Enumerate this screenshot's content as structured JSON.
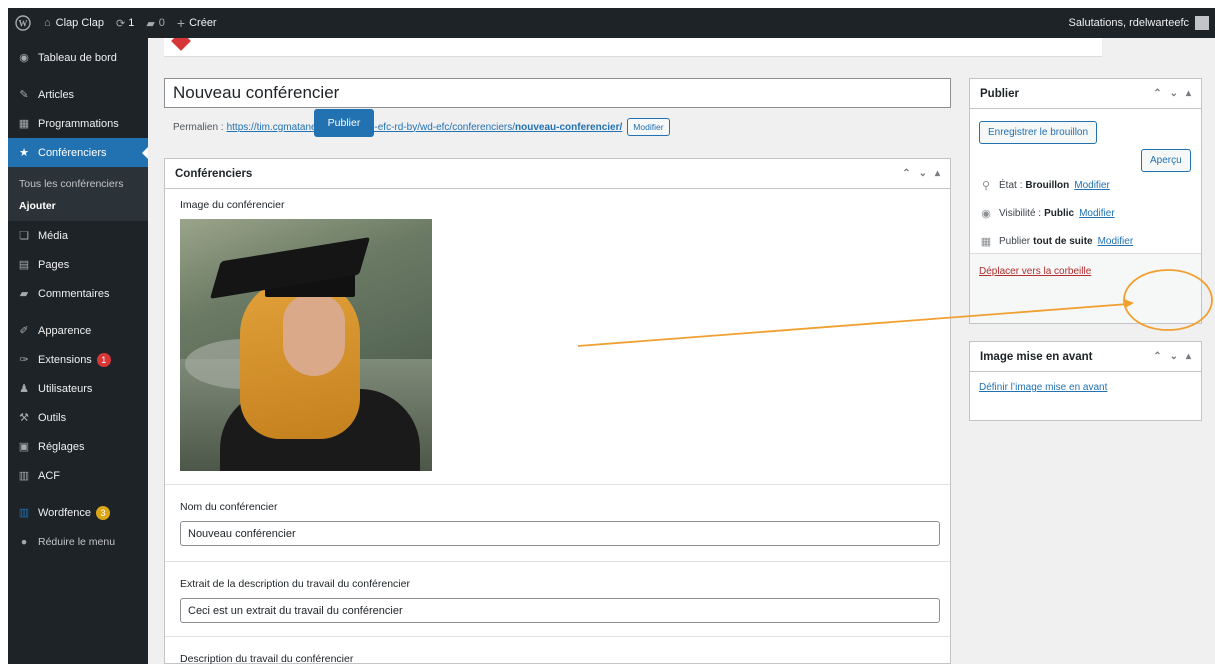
{
  "adminbar": {
    "site_name": "Clap Clap",
    "updates_count": "1",
    "comments_count": "0",
    "new_label": "Créer",
    "greeting": "Salutations, rdelwarteefc"
  },
  "sidebar": {
    "dashboard": "Tableau de bord",
    "articles": "Articles",
    "programmations": "Programmations",
    "conferenciers": "Conférenciers",
    "sub_all": "Tous les conférenciers",
    "sub_add": "Ajouter",
    "media": "Média",
    "pages": "Pages",
    "comments": "Commentaires",
    "appearance": "Apparence",
    "extensions": "Extensions",
    "extensions_badge": "1",
    "users": "Utilisateurs",
    "tools": "Outils",
    "settings": "Réglages",
    "acf": "ACF",
    "wordfence": "Wordfence",
    "wordfence_badge": "3",
    "collapse": "Réduire le menu"
  },
  "editor": {
    "title_value": "Nouveau conférencier",
    "permalink_label": "Permalien :",
    "permalink_base": "https://tim.cgmatane.qc.ca/wd/wd-efc-rd-by/wd-efc/conferenciers/",
    "permalink_slug": "nouveau-conferencier/",
    "permalink_edit": "Modifier"
  },
  "speakers_box": {
    "title": "Conférenciers",
    "image_label": "Image du conférencier",
    "name_label": "Nom du conférencier",
    "name_value": "Nouveau conférencier",
    "excerpt_label": "Extrait de la description du travail du conférencier",
    "excerpt_value": "Ceci est un extrait du travail du conférencier",
    "description_label": "Description du travail du conférencier"
  },
  "publish_box": {
    "title": "Publier",
    "save_draft": "Enregistrer le brouillon",
    "preview": "Aperçu",
    "status_label": "État :",
    "status_value": "Brouillon",
    "visibility_label": "Visibilité :",
    "visibility_value": "Public",
    "schedule_label": "Publier",
    "schedule_value": "tout de suite",
    "edit_link": "Modifier",
    "trash": "Déplacer vers la corbeille",
    "publish": "Publier"
  },
  "featured_box": {
    "title": "Image mise en avant",
    "set_link": "Définir l’image mise en avant"
  },
  "colors": {
    "admin_dark": "#1d2327",
    "accent_blue": "#2271b1",
    "annotation_orange": "#f0a030"
  }
}
